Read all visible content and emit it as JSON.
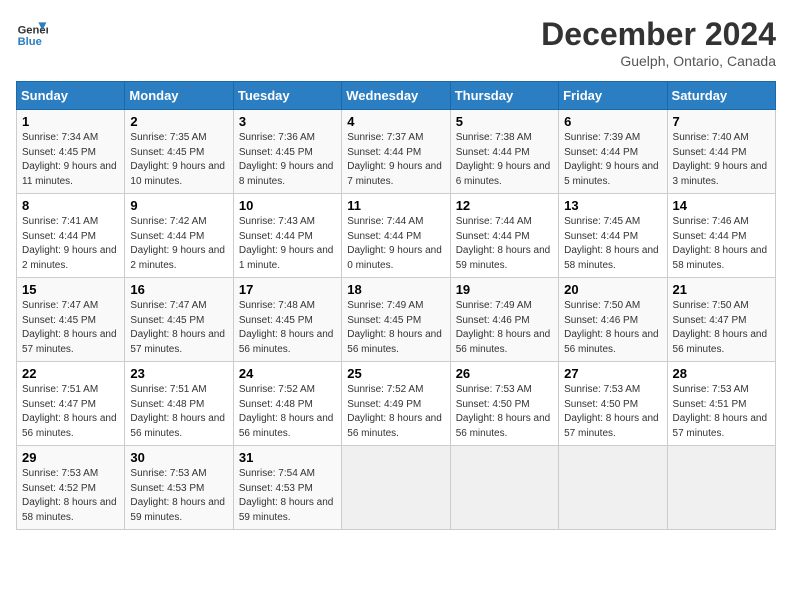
{
  "header": {
    "logo_line1": "General",
    "logo_line2": "Blue",
    "title": "December 2024",
    "location": "Guelph, Ontario, Canada"
  },
  "weekdays": [
    "Sunday",
    "Monday",
    "Tuesday",
    "Wednesday",
    "Thursday",
    "Friday",
    "Saturday"
  ],
  "weeks": [
    [
      {
        "day": "1",
        "sunrise": "7:34 AM",
        "sunset": "4:45 PM",
        "daylight": "9 hours and 11 minutes."
      },
      {
        "day": "2",
        "sunrise": "7:35 AM",
        "sunset": "4:45 PM",
        "daylight": "9 hours and 10 minutes."
      },
      {
        "day": "3",
        "sunrise": "7:36 AM",
        "sunset": "4:45 PM",
        "daylight": "9 hours and 8 minutes."
      },
      {
        "day": "4",
        "sunrise": "7:37 AM",
        "sunset": "4:44 PM",
        "daylight": "9 hours and 7 minutes."
      },
      {
        "day": "5",
        "sunrise": "7:38 AM",
        "sunset": "4:44 PM",
        "daylight": "9 hours and 6 minutes."
      },
      {
        "day": "6",
        "sunrise": "7:39 AM",
        "sunset": "4:44 PM",
        "daylight": "9 hours and 5 minutes."
      },
      {
        "day": "7",
        "sunrise": "7:40 AM",
        "sunset": "4:44 PM",
        "daylight": "9 hours and 3 minutes."
      }
    ],
    [
      {
        "day": "8",
        "sunrise": "7:41 AM",
        "sunset": "4:44 PM",
        "daylight": "9 hours and 2 minutes."
      },
      {
        "day": "9",
        "sunrise": "7:42 AM",
        "sunset": "4:44 PM",
        "daylight": "9 hours and 2 minutes."
      },
      {
        "day": "10",
        "sunrise": "7:43 AM",
        "sunset": "4:44 PM",
        "daylight": "9 hours and 1 minute."
      },
      {
        "day": "11",
        "sunrise": "7:44 AM",
        "sunset": "4:44 PM",
        "daylight": "9 hours and 0 minutes."
      },
      {
        "day": "12",
        "sunrise": "7:44 AM",
        "sunset": "4:44 PM",
        "daylight": "8 hours and 59 minutes."
      },
      {
        "day": "13",
        "sunrise": "7:45 AM",
        "sunset": "4:44 PM",
        "daylight": "8 hours and 58 minutes."
      },
      {
        "day": "14",
        "sunrise": "7:46 AM",
        "sunset": "4:44 PM",
        "daylight": "8 hours and 58 minutes."
      }
    ],
    [
      {
        "day": "15",
        "sunrise": "7:47 AM",
        "sunset": "4:45 PM",
        "daylight": "8 hours and 57 minutes."
      },
      {
        "day": "16",
        "sunrise": "7:47 AM",
        "sunset": "4:45 PM",
        "daylight": "8 hours and 57 minutes."
      },
      {
        "day": "17",
        "sunrise": "7:48 AM",
        "sunset": "4:45 PM",
        "daylight": "8 hours and 56 minutes."
      },
      {
        "day": "18",
        "sunrise": "7:49 AM",
        "sunset": "4:45 PM",
        "daylight": "8 hours and 56 minutes."
      },
      {
        "day": "19",
        "sunrise": "7:49 AM",
        "sunset": "4:46 PM",
        "daylight": "8 hours and 56 minutes."
      },
      {
        "day": "20",
        "sunrise": "7:50 AM",
        "sunset": "4:46 PM",
        "daylight": "8 hours and 56 minutes."
      },
      {
        "day": "21",
        "sunrise": "7:50 AM",
        "sunset": "4:47 PM",
        "daylight": "8 hours and 56 minutes."
      }
    ],
    [
      {
        "day": "22",
        "sunrise": "7:51 AM",
        "sunset": "4:47 PM",
        "daylight": "8 hours and 56 minutes."
      },
      {
        "day": "23",
        "sunrise": "7:51 AM",
        "sunset": "4:48 PM",
        "daylight": "8 hours and 56 minutes."
      },
      {
        "day": "24",
        "sunrise": "7:52 AM",
        "sunset": "4:48 PM",
        "daylight": "8 hours and 56 minutes."
      },
      {
        "day": "25",
        "sunrise": "7:52 AM",
        "sunset": "4:49 PM",
        "daylight": "8 hours and 56 minutes."
      },
      {
        "day": "26",
        "sunrise": "7:53 AM",
        "sunset": "4:50 PM",
        "daylight": "8 hours and 56 minutes."
      },
      {
        "day": "27",
        "sunrise": "7:53 AM",
        "sunset": "4:50 PM",
        "daylight": "8 hours and 57 minutes."
      },
      {
        "day": "28",
        "sunrise": "7:53 AM",
        "sunset": "4:51 PM",
        "daylight": "8 hours and 57 minutes."
      }
    ],
    [
      {
        "day": "29",
        "sunrise": "7:53 AM",
        "sunset": "4:52 PM",
        "daylight": "8 hours and 58 minutes."
      },
      {
        "day": "30",
        "sunrise": "7:53 AM",
        "sunset": "4:53 PM",
        "daylight": "8 hours and 59 minutes."
      },
      {
        "day": "31",
        "sunrise": "7:54 AM",
        "sunset": "4:53 PM",
        "daylight": "8 hours and 59 minutes."
      },
      null,
      null,
      null,
      null
    ]
  ]
}
